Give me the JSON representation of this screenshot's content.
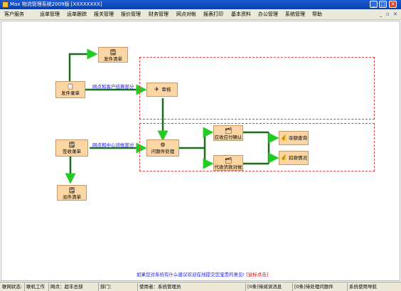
{
  "window": {
    "title": "Max 物流管理系统2009版 [XXXXXXXX]"
  },
  "menu": [
    "客户服务",
    "运单管理",
    "运单跟踪",
    "报关管理",
    "报价管理",
    "财务管理",
    "网点对帐",
    "报表打印",
    "基本资料",
    "办公管理",
    "系统管理",
    "帮助"
  ],
  "menu_controls": {
    "min": "_",
    "restore": "▫",
    "close": "✕"
  },
  "flow": {
    "nodes": {
      "send_register": "发件录单",
      "send_list": "发件清单",
      "audit": "审核",
      "receive_register": "签收录单",
      "deliver_list": "派件清单",
      "problem_handling": "问题件处理",
      "receivable_confirm": "应收应付确认",
      "cod_reconcile": "代收货款对帐",
      "balance_query": "余额查询",
      "deduction_status": "扣款情况"
    },
    "labels": {
      "customer_settlement": "网点和客户结算部分",
      "center_reconcile": "网点和中心对帐部分"
    }
  },
  "notice": {
    "text": "如果您对系统有什么建议欢迎在线提交您宝贵的意见!",
    "link": "[鼠标点击]"
  },
  "status": {
    "conn_label": "联网状态:",
    "conn_value": "联机工作",
    "site": "网点：超丰总部",
    "dept": "部门：",
    "user": "使用者：系统管理员",
    "unread": "[0条]待阅读消息",
    "pending": "[0条]待处理问题件",
    "nav": "系统使用导航"
  }
}
